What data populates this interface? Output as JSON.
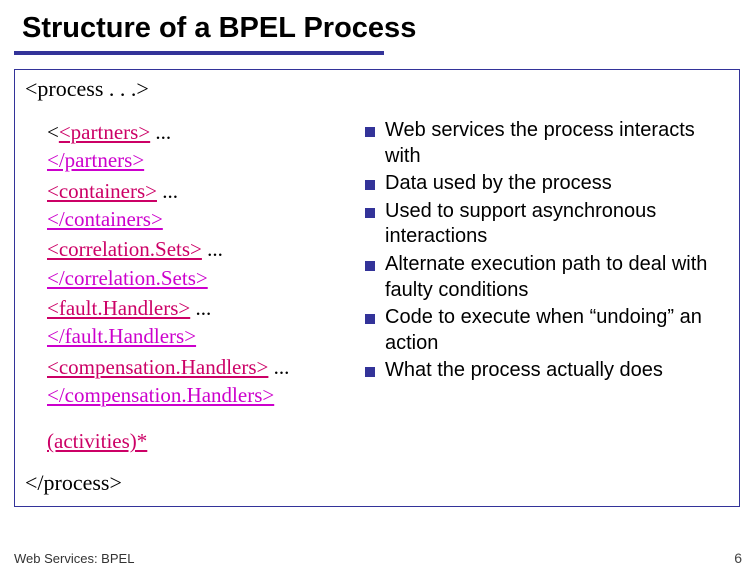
{
  "title": "Structure of a BPEL Process",
  "process_open": "<process . . .>",
  "process_close": "</process>",
  "xml_elements": [
    {
      "open": "<partners>",
      "ellipsis": " ... ",
      "close": "</partners>"
    },
    {
      "open": "<containers>",
      "ellipsis": " ... ",
      "close": "</containers>"
    },
    {
      "open": "<correlation.Sets>",
      "ellipsis": " ... ",
      "close": "</correlation.Sets>"
    },
    {
      "open": "<fault.Handlers>",
      "ellipsis": " ... ",
      "close": "</fault.Handlers>"
    },
    {
      "open": "<compensation.Handlers>",
      "ellipsis": " ... ",
      "close": "</compensation.Handlers>"
    }
  ],
  "activities_label": "(activities)*",
  "bullets": [
    "Web services the process interacts with",
    "Data used by the process",
    "Used to support asynchronous interactions",
    "Alternate execution path to deal with faulty conditions",
    "Code to execute when “undoing” an action",
    "What the process actually does"
  ],
  "footer": "Web Services: BPEL",
  "page_number": "6"
}
